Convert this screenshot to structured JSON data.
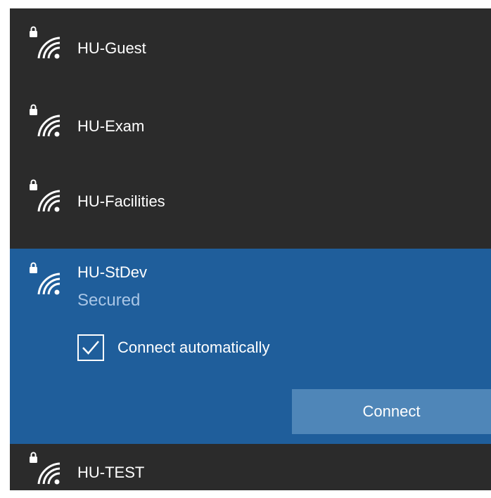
{
  "networks": [
    {
      "ssid": "HU-Guest",
      "secured": true
    },
    {
      "ssid": "HU-Exam",
      "secured": true
    },
    {
      "ssid": "HU-Facilities",
      "secured": true
    },
    {
      "ssid": "HU-StDev",
      "secured": true,
      "status": "Secured",
      "selected": true
    },
    {
      "ssid": "HU-TEST",
      "secured": true
    }
  ],
  "selected_network": {
    "connect_automatically_label": "Connect automatically",
    "connect_automatically_checked": true,
    "connect_button_label": "Connect"
  },
  "icons": {
    "network": "wifi-secured-icon",
    "checkbox": "checkmark-icon"
  },
  "colors": {
    "flyout_background": "#2b2b2b",
    "selected_background": "#1f5e9b",
    "button_background": "#4f86b8",
    "secured_text": "#a9c6e6",
    "text": "#ffffff"
  }
}
